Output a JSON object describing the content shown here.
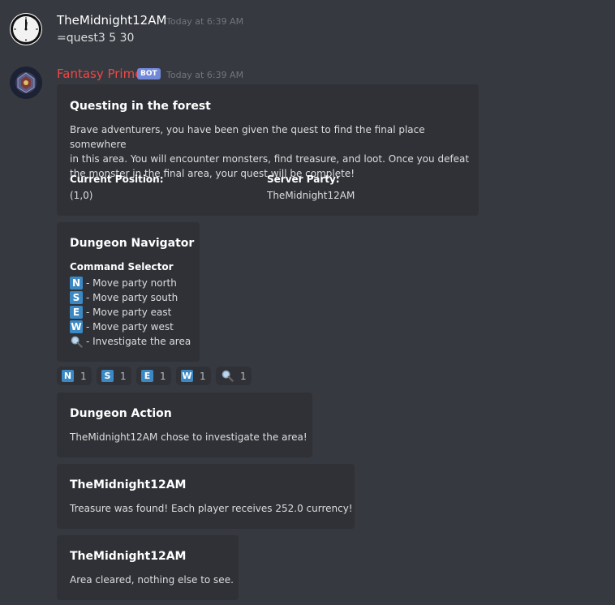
{
  "messages": [
    {
      "author": "TheMidnight12AM",
      "timestamp": "Today at 6:39 AM",
      "avatar_icon": "clock-icon",
      "text": "=quest3 5 30"
    },
    {
      "author": "Fantasy Prime",
      "bot_tag": "BOT",
      "timestamp": "Today at 6:39 AM",
      "avatar_icon": "fantasy-avatar-icon"
    }
  ],
  "embeds": {
    "quest": {
      "title": "Questing in the forest",
      "description_lines": [
        "Brave adventurers, you have been given the quest to find the final place somewhere",
        "in this area. You will encounter monsters, find treasure, and loot. Once you defeat",
        "the monster in the final area, your quest will be complete!"
      ],
      "fields": [
        {
          "name": "Current Position:",
          "value": "(1,0)"
        },
        {
          "name": "Server Party:",
          "value": "TheMidnight12AM"
        }
      ]
    },
    "navigator": {
      "title": "Dungeon Navigator",
      "subtitle": "Command Selector",
      "commands": [
        {
          "key": "N",
          "label": "- Move party north"
        },
        {
          "key": "S",
          "label": "- Move party south"
        },
        {
          "key": "E",
          "label": "- Move party east"
        },
        {
          "key": "W",
          "label": "- Move party west"
        },
        {
          "key": "magnifier",
          "label": "- Investigate the area"
        }
      ]
    },
    "action": {
      "title": "Dungeon Action",
      "description": "TheMidnight12AM chose to investigate the area!"
    },
    "treasure": {
      "title": "TheMidnight12AM",
      "description": "Treasure was found! Each player receives 252.0 currency!"
    },
    "cleared": {
      "title": "TheMidnight12AM",
      "description": "Area cleared, nothing else to see."
    }
  },
  "reactions": [
    {
      "emoji": "N",
      "count": "1"
    },
    {
      "emoji": "S",
      "count": "1"
    },
    {
      "emoji": "E",
      "count": "1"
    },
    {
      "emoji": "W",
      "count": "1"
    },
    {
      "emoji": "magnifier",
      "count": "1"
    }
  ],
  "colors": {
    "background": "#36393f",
    "embed_bg": "#2f3136",
    "key_blue": "#3b88c3",
    "bot_name": "#f04747",
    "bot_tag": "#7289da"
  }
}
